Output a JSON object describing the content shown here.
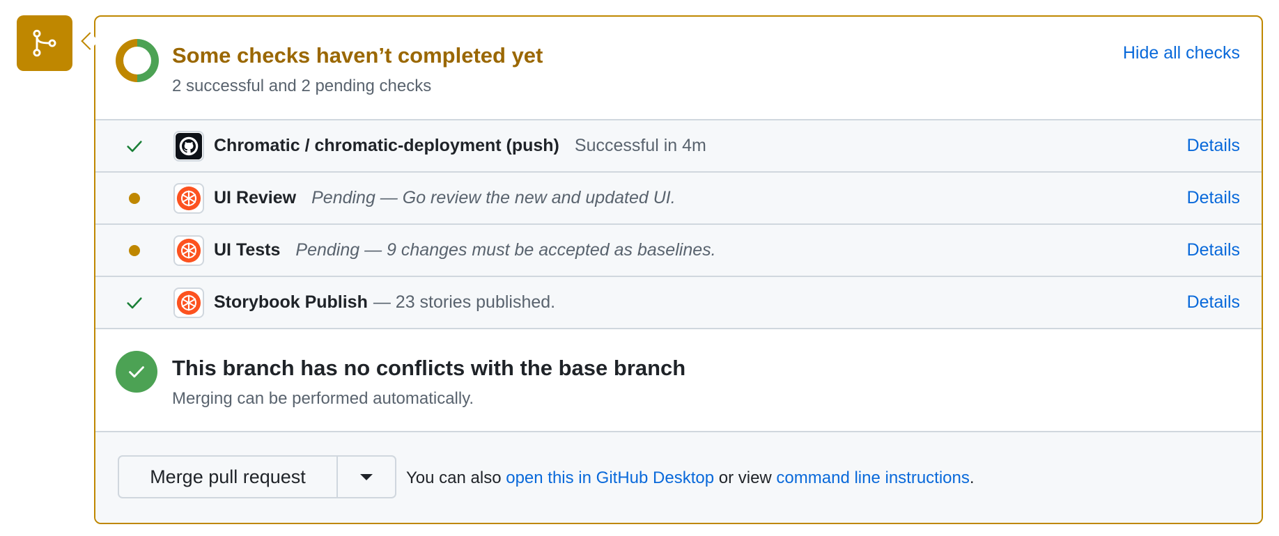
{
  "status": {
    "title": "Some checks haven’t completed yet",
    "subtitle": "2 successful and 2 pending checks",
    "hide_label": "Hide all checks",
    "colors": {
      "pending": "#bf8700",
      "success": "#4ca254"
    }
  },
  "checks": [
    {
      "state": "success",
      "icon": "github-icon",
      "name": "Chromatic / chromatic-deployment (push)",
      "description": "Successful in 4m",
      "details_label": "Details"
    },
    {
      "state": "pending",
      "icon": "chromatic-icon",
      "name": "UI Review",
      "description": "Pending — Go review the new and updated UI.",
      "details_label": "Details"
    },
    {
      "state": "pending",
      "icon": "chromatic-icon",
      "name": "UI Tests",
      "description": "Pending — 9 changes must be accepted as baselines.",
      "details_label": "Details"
    },
    {
      "state": "success",
      "icon": "chromatic-icon",
      "name": "Storybook Publish",
      "description": "— 23 stories published.",
      "details_label": "Details"
    }
  ],
  "conflicts": {
    "title": "This branch has no conflicts with the base branch",
    "subtitle": "Merging can be performed automatically."
  },
  "merge": {
    "button_label": "Merge pull request",
    "note_prefix": "You can also ",
    "desktop_link": "open this in GitHub Desktop",
    "note_middle": " or view ",
    "cli_link": "command line instructions",
    "note_suffix": "."
  }
}
